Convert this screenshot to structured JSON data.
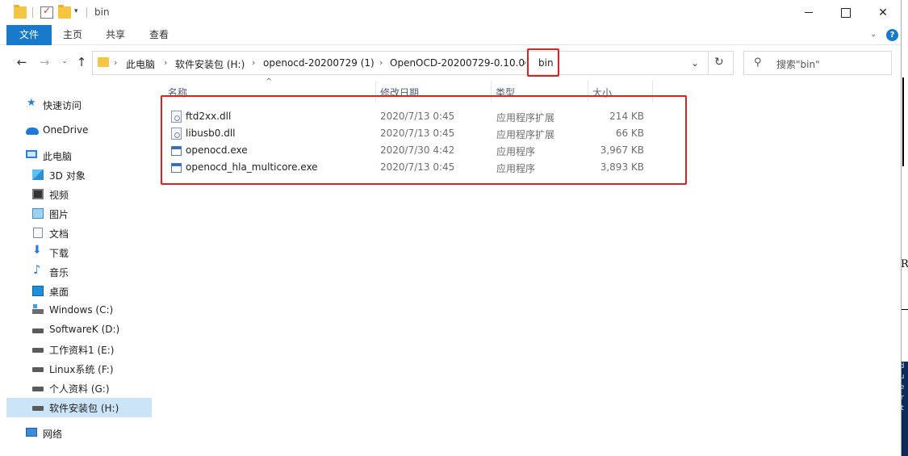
{
  "window": {
    "title": "bin",
    "quick_access_dropdown": "▾",
    "minimize_label": "",
    "maximize_label": "",
    "close_label": "✕"
  },
  "ribbon": {
    "tabs": [
      {
        "label": "文件"
      },
      {
        "label": "主页"
      },
      {
        "label": "共享"
      },
      {
        "label": "查看"
      }
    ],
    "expand": "⌄",
    "help": "?"
  },
  "nav": {
    "back": "←",
    "forward": "→",
    "recent": "⌄",
    "up": "↑"
  },
  "address": {
    "breadcrumbs": [
      {
        "label": "此电脑"
      },
      {
        "label": "软件安装包 (H:)"
      },
      {
        "label": "openocd-20200729 (1)"
      },
      {
        "label": "OpenOCD-20200729-0.10.0"
      },
      {
        "label": "bin"
      }
    ],
    "separator": "›",
    "dropdown": "⌄",
    "refresh": "↻"
  },
  "search": {
    "icon": "⚲",
    "placeholder": "搜索\"bin\""
  },
  "sidebar": {
    "items": [
      {
        "label": "快速访问",
        "icon": "star-icon"
      },
      {
        "label": "OneDrive",
        "icon": "cloud-icon"
      },
      {
        "label": "此电脑",
        "icon": "computer-icon"
      },
      {
        "label": "3D 对象",
        "icon": "cube-icon"
      },
      {
        "label": "视频",
        "icon": "video-icon"
      },
      {
        "label": "图片",
        "icon": "picture-icon"
      },
      {
        "label": "文档",
        "icon": "document-icon"
      },
      {
        "label": "下载",
        "icon": "download-icon"
      },
      {
        "label": "音乐",
        "icon": "music-icon"
      },
      {
        "label": "桌面",
        "icon": "desktop-icon"
      },
      {
        "label": "Windows (C:)",
        "icon": "windows-drive-icon"
      },
      {
        "label": "SoftwareK (D:)",
        "icon": "drive-icon"
      },
      {
        "label": "工作资料1 (E:)",
        "icon": "drive-icon"
      },
      {
        "label": "Linux系统 (F:)",
        "icon": "drive-icon"
      },
      {
        "label": "个人资料 (G:)",
        "icon": "drive-icon"
      },
      {
        "label": "软件安装包 (H:)",
        "icon": "drive-icon",
        "selected": true
      },
      {
        "label": "网络",
        "icon": "network-icon"
      }
    ]
  },
  "filelist": {
    "sort_indicator": "^",
    "columns": [
      {
        "label": "名称"
      },
      {
        "label": "修改日期"
      },
      {
        "label": "类型"
      },
      {
        "label": "大小"
      }
    ],
    "rows": [
      {
        "name": "ftd2xx.dll",
        "date": "2020/7/13 0:45",
        "type": "应用程序扩展",
        "size": "214 KB",
        "icon": "dll-file-icon"
      },
      {
        "name": "libusb0.dll",
        "date": "2020/7/13 0:45",
        "type": "应用程序扩展",
        "size": "66 KB",
        "icon": "dll-file-icon"
      },
      {
        "name": "openocd.exe",
        "date": "2020/7/30 4:42",
        "type": "应用程序",
        "size": "3,967 KB",
        "icon": "exe-file-icon"
      },
      {
        "name": "openocd_hla_multicore.exe",
        "date": "2020/7/13 0:45",
        "type": "应用程序",
        "size": "3,893 KB",
        "icon": "exe-file-icon"
      }
    ]
  },
  "backdrop": {
    "left_fragment": "幕",
    "right_fragment": "R"
  },
  "colors": {
    "accent": "#1979ca",
    "highlight": "#e02020",
    "selected": "#cce4f7"
  }
}
